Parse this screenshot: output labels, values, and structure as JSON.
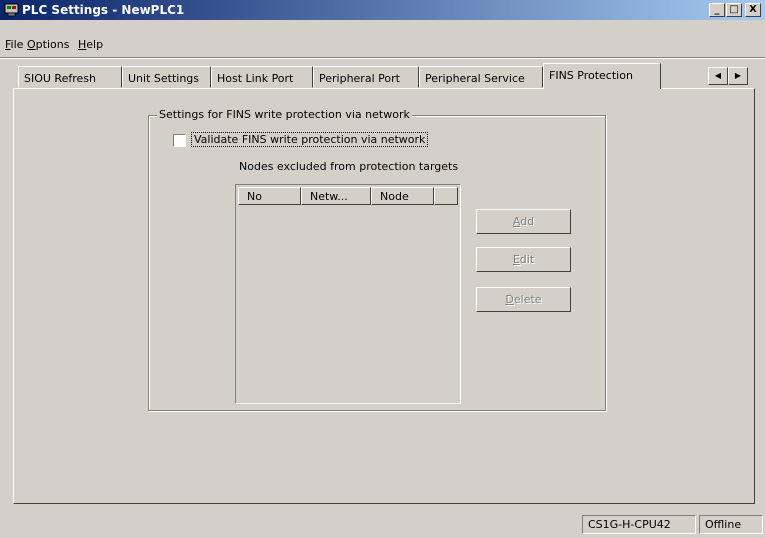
{
  "window": {
    "title": "PLC Settings - NewPLC1",
    "minimize": "_",
    "maximize": "□",
    "close": "X"
  },
  "menu": {
    "items": [
      {
        "mnemonic": "F",
        "rest": "ile"
      },
      {
        "mnemonic": "O",
        "rest": "ptions"
      },
      {
        "mnemonic": "H",
        "rest": "elp"
      }
    ]
  },
  "tabs": [
    "SIOU Refresh",
    "Unit Settings",
    "Host Link Port",
    "Peripheral Port",
    "Peripheral Service",
    "FINS Protection"
  ],
  "active_tab": "FINS Protection",
  "fins": {
    "group_title": "Settings for FINS write protection via network",
    "checkbox_label": "Validate FINS write protection via network",
    "checkbox_checked": false,
    "nodes_label": "Nodes excluded from protection targets",
    "columns": [
      "No",
      "Netw...",
      "Node"
    ],
    "rows": []
  },
  "buttons": {
    "add": {
      "mnemonic": "A",
      "rest": "dd"
    },
    "edit": {
      "mnemonic": "E",
      "rest": "dit"
    },
    "delete": {
      "mnemonic": "D",
      "rest": "elete"
    }
  },
  "status": {
    "model": "CS1G-H-CPU42",
    "mode": "Offline"
  },
  "icons": {
    "app": "plc-app-icon",
    "scroll_left": "left-arrow-icon",
    "scroll_right": "right-arrow-icon"
  }
}
